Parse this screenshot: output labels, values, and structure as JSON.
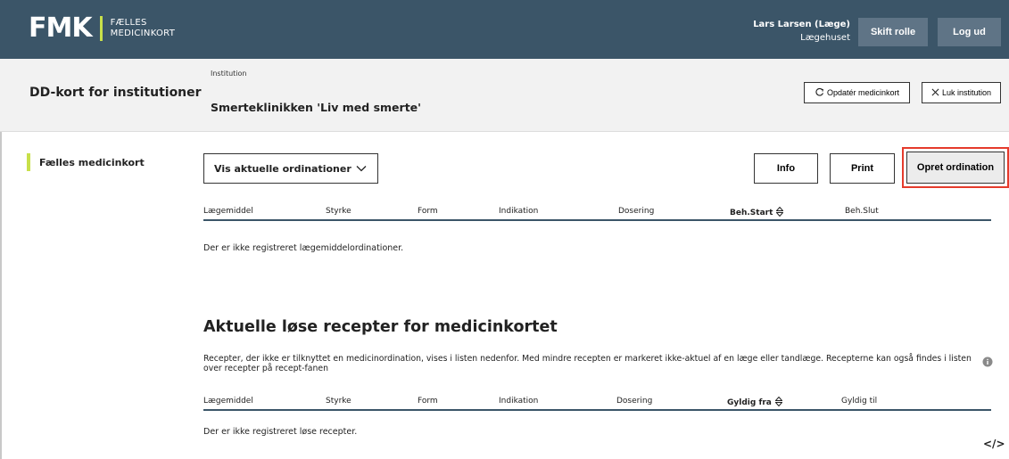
{
  "header": {
    "logo_mark": "FMK",
    "logo_line1": "FÆLLES",
    "logo_line2": "MEDICINKORT",
    "user_name": "Lars Larsen (Læge)",
    "user_org": "Lægehuset",
    "switch_role_label": "Skift rolle",
    "logout_label": "Log ud"
  },
  "subheader": {
    "title": "DD-kort for institutioner",
    "institution_label": "Institution",
    "institution_name": "Smerteklinikken 'Liv med smerte'",
    "refresh_label": "Opdatér medicinkort",
    "close_label": "Luk institution"
  },
  "sidebar": {
    "items": [
      {
        "label": "Fælles medicinkort"
      }
    ]
  },
  "toolbar": {
    "dropdown_value": "Vis aktuelle ordinationer",
    "info_label": "Info",
    "print_label": "Print",
    "create_label": "Opret ordination"
  },
  "ordinations_table": {
    "columns": [
      "Lægemiddel",
      "Styrke",
      "Form",
      "Indikation",
      "Dosering",
      "Beh.Start",
      "Beh.Slut"
    ],
    "empty_text": "Der er ikke registreret lægemiddelordinationer."
  },
  "prescriptions": {
    "title": "Aktuelle løse recepter for medicinkortet",
    "description": "Recepter, der ikke er tilknyttet en medicinordination, vises i listen nedenfor. Med mindre recepten er markeret ikke-aktuel af en læge eller tandlæge. Recepterne kan også findes i listen over recepter på recept-fanen",
    "columns": [
      "Lægemiddel",
      "Styrke",
      "Form",
      "Indikation",
      "Dosering",
      "Gyldig fra",
      "Gyldig til"
    ],
    "empty_text": "Der er ikke registreret løse recepter."
  },
  "footer": {
    "code_icon_text": "</>"
  },
  "colors": {
    "topbar": "#3b5568",
    "accent": "#c8e04a",
    "highlight": "#e53b2c"
  },
  "icons": [
    "refresh-icon",
    "close-icon",
    "chevron-down-icon",
    "sort-icon",
    "info-icon",
    "code-icon"
  ]
}
